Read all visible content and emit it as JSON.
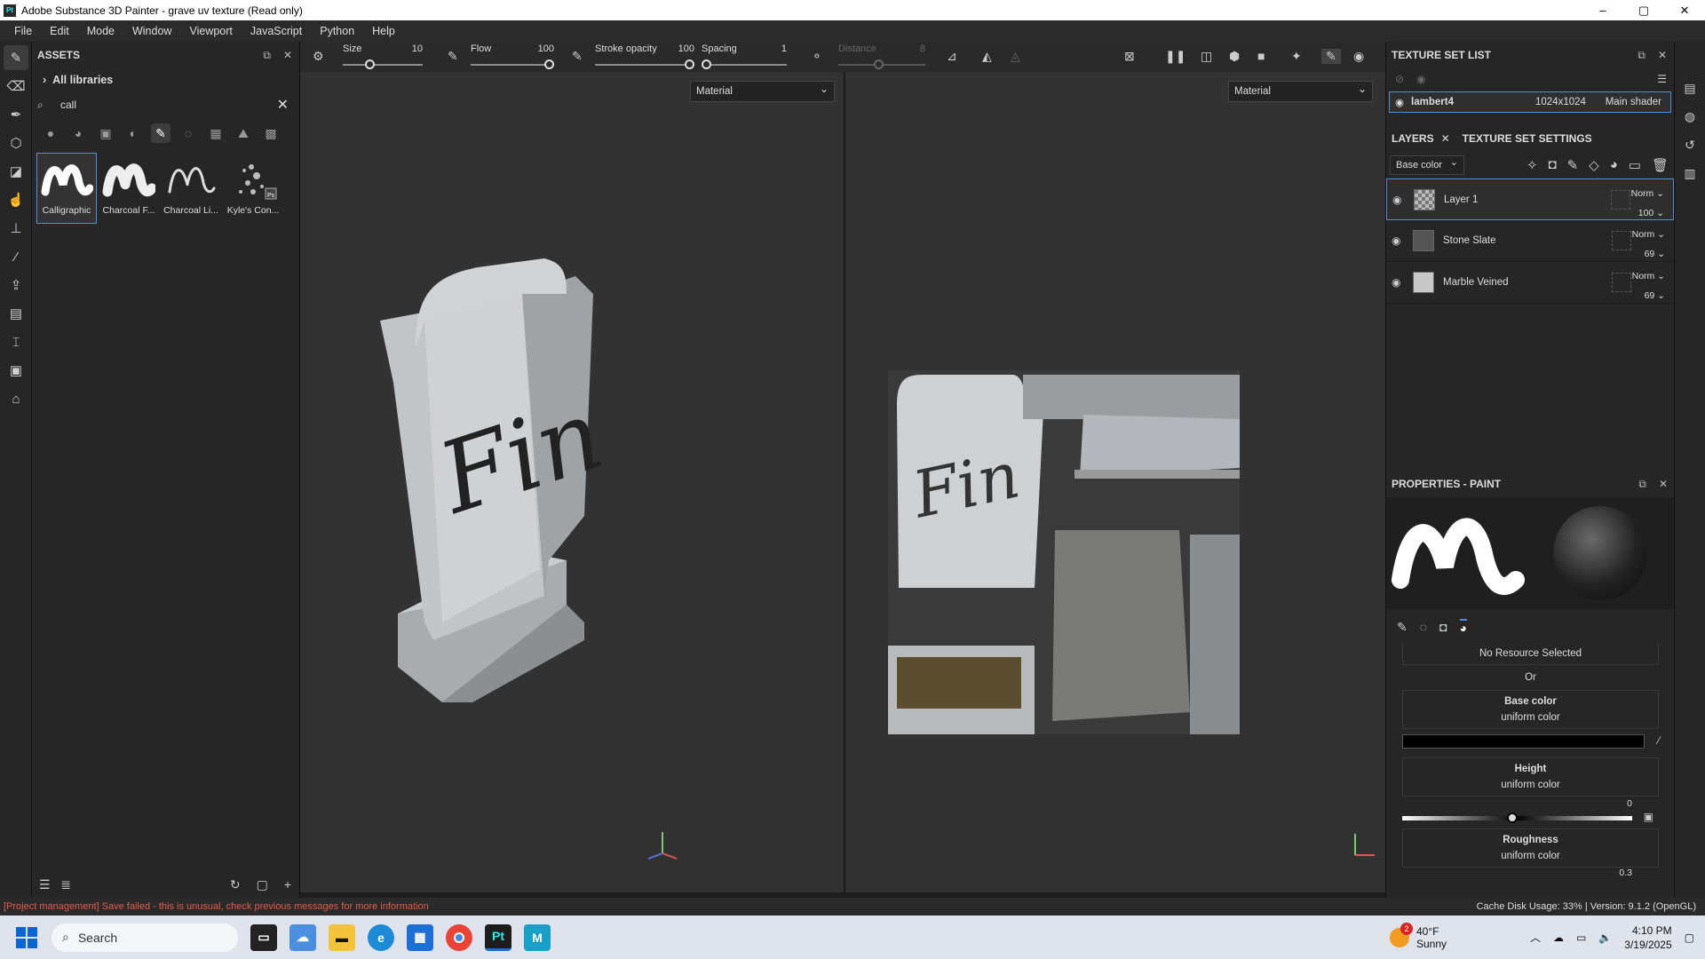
{
  "app": {
    "title": "Adobe Substance 3D Painter - grave uv texture (Read only)",
    "logo": "Pt"
  },
  "window_controls": {
    "minimize": "–",
    "maximize": "▢",
    "close": "✕"
  },
  "menu": [
    "File",
    "Edit",
    "Mode",
    "Window",
    "Viewport",
    "JavaScript",
    "Python",
    "Help"
  ],
  "assets": {
    "title": "ASSETS",
    "library": "All libraries",
    "search_value": "call",
    "items": [
      {
        "label": "Calligraphic",
        "selected": true
      },
      {
        "label": "Charcoal F...",
        "selected": false
      },
      {
        "label": "Charcoal Li...",
        "selected": false
      },
      {
        "label": "Kyle's Con...",
        "selected": false
      }
    ]
  },
  "toolbar": {
    "size_label": "Size",
    "size_value": "10",
    "flow_label": "Flow",
    "flow_value": "100",
    "stroke_label": "Stroke opacity",
    "stroke_value": "100",
    "spacing_label": "Spacing",
    "spacing_value": "1",
    "distance_label": "Distance",
    "distance_value": "8"
  },
  "viewport": {
    "left_mode": "Material",
    "right_mode": "Material",
    "model_text": "Fin"
  },
  "texture_set_list": {
    "title": "TEXTURE SET LIST",
    "set_name": "lambert4",
    "resolution": "1024x1024",
    "shader": "Main shader"
  },
  "layers": {
    "tab_layers": "LAYERS",
    "tab_settings": "TEXTURE SET SETTINGS",
    "channel": "Base color",
    "items": [
      {
        "name": "Layer 1",
        "blend": "Norm",
        "opacity": "100",
        "selected": true
      },
      {
        "name": "Stone Slate",
        "blend": "Norm",
        "opacity": "69",
        "selected": false
      },
      {
        "name": "Marble Veined",
        "blend": "Norm",
        "opacity": "69",
        "selected": false
      }
    ]
  },
  "properties": {
    "title": "PROPERTIES - PAINT",
    "no_resource": "No Resource Selected",
    "or": "Or",
    "base_color": "Base color",
    "base_color_sub": "uniform color",
    "height": "Height",
    "height_sub": "uniform color",
    "height_value": "0",
    "roughness": "Roughness",
    "roughness_sub": "uniform color",
    "roughness_value": "0.3"
  },
  "status": {
    "error": "[Project management] Save failed - this is unusual, check previous messages for more information",
    "right": "Cache Disk Usage:   33% | Version: 9.1.2 (OpenGL)"
  },
  "taskbar": {
    "search": "Search",
    "weather_badge": "2",
    "temp": "40°F",
    "weather": "Sunny",
    "time": "4:10 PM",
    "date": "3/19/2025"
  }
}
